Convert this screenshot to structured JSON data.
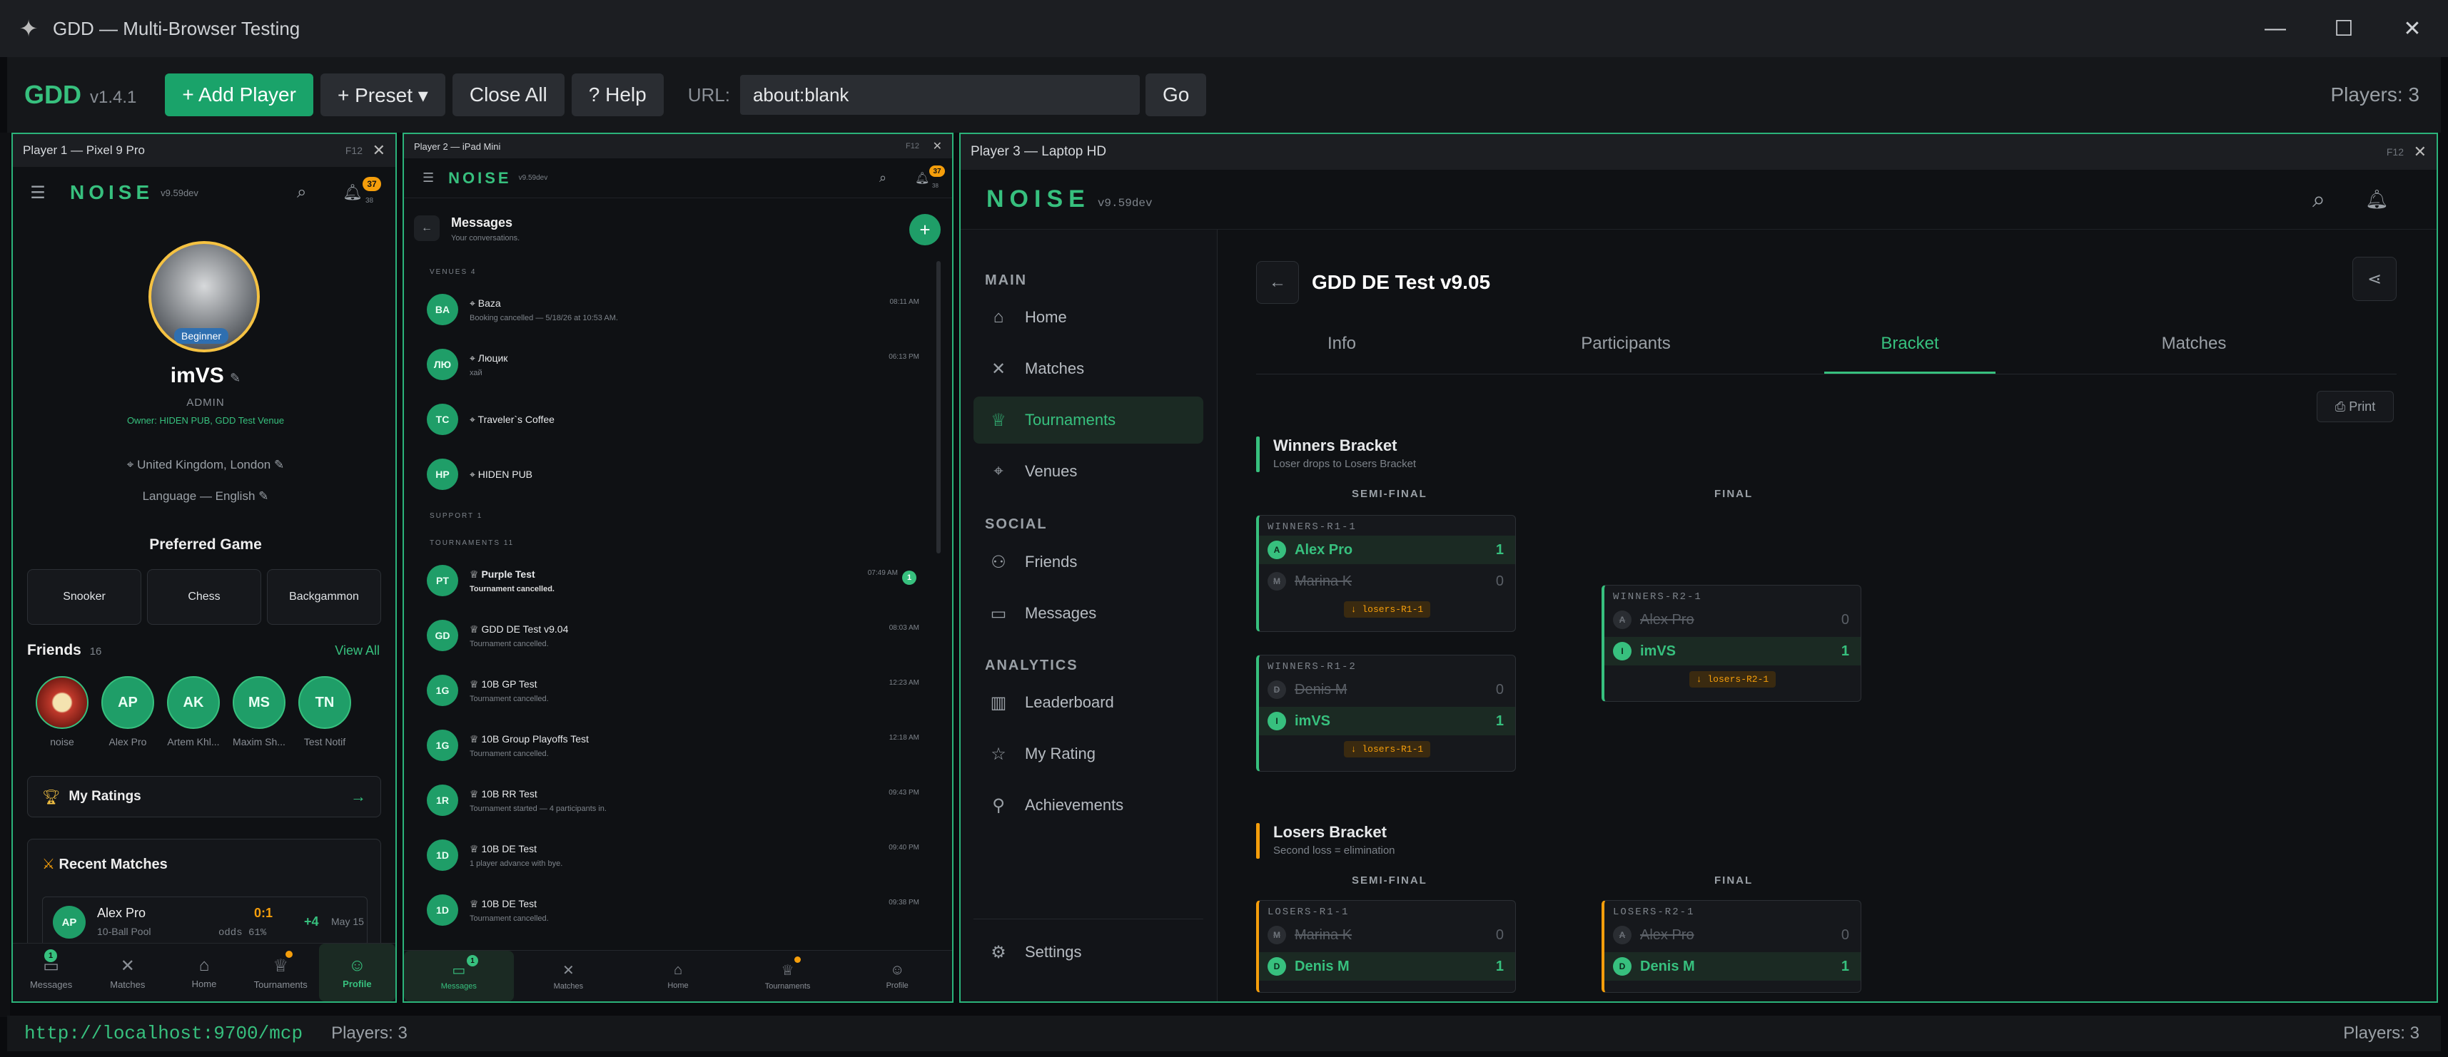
{
  "window": {
    "title": "GDD — Multi-Browser Testing"
  },
  "toolbar": {
    "brand": "GDD",
    "version": "v1.4.1",
    "add_player": "+ Add Player",
    "preset": "+ Preset ▾",
    "close_all": "Close All",
    "help": "? Help",
    "url_label": "URL:",
    "url_value": "about:blank",
    "go": "Go",
    "players": "Players: 3"
  },
  "status": {
    "url": "http://localhost:9700/mcp",
    "players": "Players: 3",
    "players_right": "Players: 3"
  },
  "p1": {
    "title": "Player 1 — Pixel 9 Pro",
    "f12": "F12",
    "logo": "NOISE",
    "ver": "v9.59dev",
    "notif_badge": "37",
    "notif_sub": "38",
    "avatar_badge": "Beginner",
    "username": "imVS",
    "role": "ADMIN",
    "owner": "Owner: HIDEN PUB, GDD Test Venue",
    "location": "United Kingdom, London",
    "language": "Language — English",
    "preferred_title": "Preferred Game",
    "games": [
      "Snooker",
      "Chess",
      "Backgammon"
    ],
    "friends_title": "Friends",
    "friends_count": "16",
    "view_all": "View All",
    "friends": [
      {
        "initials": "",
        "name": "noise"
      },
      {
        "initials": "AP",
        "name": "Alex Pro"
      },
      {
        "initials": "AK",
        "name": "Artem Khl..."
      },
      {
        "initials": "MS",
        "name": "Maxim Sh..."
      },
      {
        "initials": "TN",
        "name": "Test Notif"
      }
    ],
    "ratings": "My Ratings",
    "ratings_arrow": "→",
    "recent_title": "Recent Matches",
    "recent": {
      "initials": "AP",
      "name": "Alex Pro",
      "game": "10-Ball Pool",
      "score": "0:1",
      "odds": "odds 61%",
      "delta": "+4",
      "date": "May 15"
    },
    "nav": [
      {
        "label": "Messages",
        "badge": "1"
      },
      {
        "label": "Matches",
        "badge": ""
      },
      {
        "label": "Home",
        "badge": ""
      },
      {
        "label": "Tournaments",
        "badge": ""
      },
      {
        "label": "Profile",
        "badge": ""
      }
    ]
  },
  "p2": {
    "title": "Player 2 — iPad Mini",
    "f12": "F12",
    "logo": "NOISE",
    "ver": "v9.59dev",
    "notif_badge": "37",
    "notif_sub": "38",
    "page_title": "Messages",
    "page_sub": "Your conversations.",
    "sec_venues": "VENUES 4",
    "sec_support": "SUPPORT 1",
    "sec_tournaments": "TOURNAMENTS 11",
    "venues": [
      {
        "initials": "BA",
        "name": "Baza",
        "preview": "Booking cancelled — 5/18/26 at 10:53 AM.",
        "time": "08:11 AM"
      },
      {
        "initials": "ЛЮ",
        "name": "Люцик",
        "preview": "хай",
        "time": "06:13 PM"
      },
      {
        "initials": "TC",
        "name": "Traveler`s Coffee",
        "preview": "",
        "time": ""
      },
      {
        "initials": "HP",
        "name": "HIDEN PUB",
        "preview": "",
        "time": ""
      }
    ],
    "tournaments": [
      {
        "initials": "PT",
        "name": "Purple Test",
        "preview": "Tournament cancelled.",
        "time": "07:49 AM",
        "unread": "1"
      },
      {
        "initials": "GD",
        "name": "GDD DE Test v9.04",
        "preview": "Tournament cancelled.",
        "time": "08:03 AM",
        "unread": ""
      },
      {
        "initials": "1G",
        "name": "10B GP Test",
        "preview": "Tournament cancelled.",
        "time": "12:23 AM",
        "unread": ""
      },
      {
        "initials": "1G",
        "name": "10B Group Playoffs Test",
        "preview": "Tournament cancelled.",
        "time": "12:18 AM",
        "unread": ""
      },
      {
        "initials": "1R",
        "name": "10B RR Test",
        "preview": "Tournament started — 4 participants in.",
        "time": "09:43 PM",
        "unread": ""
      },
      {
        "initials": "1D",
        "name": "10B DE Test",
        "preview": "1 player advance with bye.",
        "time": "09:40 PM",
        "unread": ""
      },
      {
        "initials": "1D",
        "name": "10B DE Test",
        "preview": "Tournament cancelled.",
        "time": "09:38 PM",
        "unread": ""
      }
    ],
    "nav": [
      {
        "label": "Messages",
        "badge": "1"
      },
      {
        "label": "Matches",
        "badge": ""
      },
      {
        "label": "Home",
        "badge": ""
      },
      {
        "label": "Tournaments",
        "badge": ""
      },
      {
        "label": "Profile",
        "badge": ""
      }
    ]
  },
  "p3": {
    "title": "Player 3 — Laptop HD",
    "f12": "F12",
    "logo": "NOISE",
    "ver": "v9.59dev",
    "sidebar": {
      "main": "MAIN",
      "social": "SOCIAL",
      "analytics": "ANALYTICS",
      "home": "Home",
      "matches": "Matches",
      "tournaments": "Tournaments",
      "venues": "Venues",
      "friends": "Friends",
      "messages": "Messages",
      "leaderboard": "Leaderboard",
      "rating": "My Rating",
      "achievements": "Achievements",
      "settings": "Settings"
    },
    "page_title": "GDD DE Test v9.05",
    "tabs": [
      "Info",
      "Participants",
      "Bracket",
      "Matches"
    ],
    "print": "Print",
    "winners": {
      "title": "Winners Bracket",
      "sub": "Loser drops to Losers Bracket",
      "semi": "SEMI-FINAL",
      "final": "FINAL"
    },
    "losers": {
      "title": "Losers Bracket",
      "sub": "Second loss = elimination",
      "semi": "SEMI-FINAL",
      "final": "FINAL"
    },
    "matches": {
      "wr1_1": {
        "id": "WINNERS-R1-1",
        "a": {
          "i": "A",
          "n": "Alex Pro",
          "s": "1"
        },
        "b": {
          "i": "M",
          "n": "Marina K",
          "s": "0"
        },
        "drop": "↓ losers-R1-1"
      },
      "wr1_2": {
        "id": "WINNERS-R1-2",
        "a": {
          "i": "D",
          "n": "Denis M",
          "s": "0"
        },
        "b": {
          "i": "I",
          "n": "imVS",
          "s": "1"
        },
        "drop": "↓ losers-R1-1"
      },
      "wr2_1": {
        "id": "WINNERS-R2-1",
        "a": {
          "i": "A",
          "n": "Alex Pro",
          "s": "0"
        },
        "b": {
          "i": "I",
          "n": "imVS",
          "s": "1"
        },
        "drop": "↓ losers-R2-1"
      },
      "lr1_1": {
        "id": "LOSERS-R1-1",
        "a": {
          "i": "M",
          "n": "Marina K",
          "s": "0"
        },
        "b": {
          "i": "D",
          "n": "Denis M",
          "s": "1"
        }
      },
      "lr2_1": {
        "id": "LOSERS-R2-1",
        "a": {
          "i": "A",
          "n": "Alex Pro",
          "s": "0"
        },
        "b": {
          "i": "D",
          "n": "Denis M",
          "s": "1"
        }
      }
    }
  },
  "colors": {
    "accent": "#37c07e",
    "badge": "#f59e0b",
    "bg": "#0f1114"
  }
}
